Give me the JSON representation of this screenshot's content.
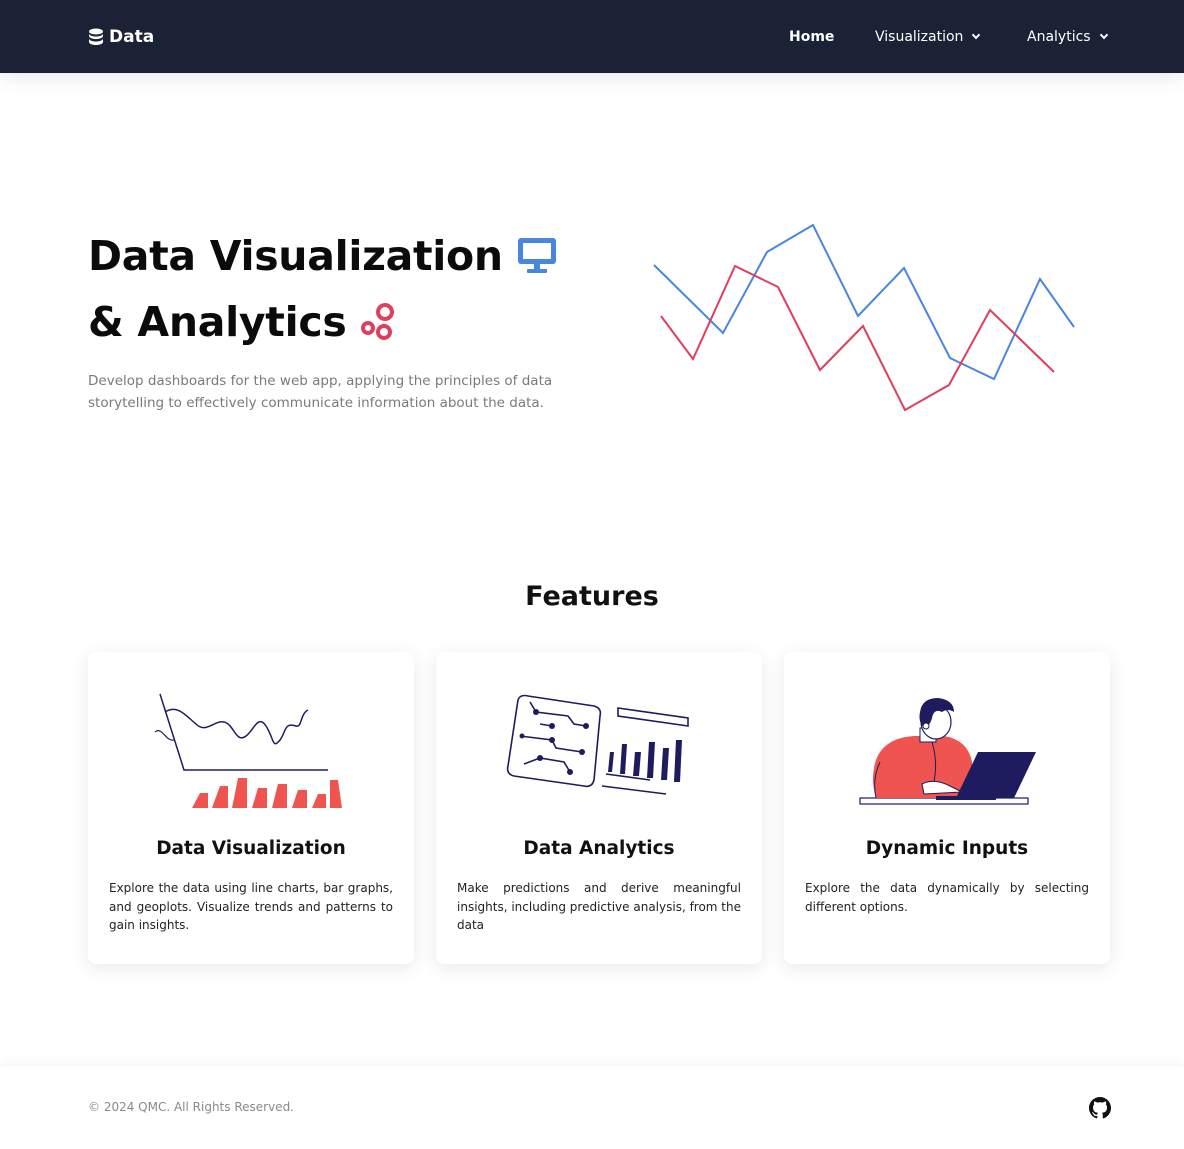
{
  "navbar": {
    "brand": "Data",
    "brand_icon": "database-icon",
    "items": [
      {
        "label": "Home",
        "active": true
      },
      {
        "label": "Visualization",
        "dropdown": true
      },
      {
        "label": "Analytics",
        "dropdown": true
      }
    ]
  },
  "hero": {
    "title_line1": "Data Visualization",
    "title_line1_icon": "monitor-icon",
    "title_line2": "& Analytics",
    "title_line2_icon": "connected-circles-icon",
    "description": "Develop dashboards for the web app, applying the principles of data storytelling to effectively communicate information about the data."
  },
  "features": {
    "title": "Features",
    "cards": [
      {
        "title": "Data Visualization",
        "text": "Explore the data using line charts, bar graphs, and geoplots. Visualize trends and patterns to gain insights.",
        "icon": "line-and-bar-chart-illustration"
      },
      {
        "title": "Data Analytics",
        "text": "Make predictions and derive meaningful insights, including predictive analysis, from the data",
        "icon": "circuit-board-and-bars-illustration"
      },
      {
        "title": "Dynamic Inputs",
        "text": "Explore the data dynamically by selecting different options.",
        "icon": "person-with-laptop-illustration"
      }
    ]
  },
  "footer": {
    "copyright": "© 2024 QMC. All Rights Reserved.",
    "icon": "github-icon"
  },
  "colors": {
    "navbar_bg": "#1b2235",
    "accent_blue": "#4a86e0",
    "accent_red": "#e03e5e",
    "illustration_red": "#ef5450",
    "illustration_navy": "#1e1b5e"
  }
}
